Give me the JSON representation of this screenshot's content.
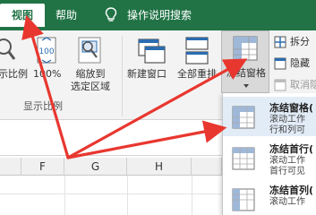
{
  "tabs": {
    "view": "视图",
    "help": "帮助",
    "tell_me": "操作说明搜索"
  },
  "ribbon": {
    "zoom_label": "示比例",
    "zoom100_label": "100%",
    "zoom_selection_line1": "缩放到",
    "zoom_selection_line2": "选定区域",
    "group_zoom": "显示比例",
    "new_window": "新建窗口",
    "arrange_all": "全部重排",
    "freeze_panes": "冻结窗格",
    "split": "拆分",
    "hide": "隐藏",
    "unhide": "取消隐"
  },
  "columns": [
    "F",
    "G",
    "H"
  ],
  "dropdown": {
    "items": [
      {
        "title": "冻结窗格(",
        "desc1": "滚动工作",
        "desc2": "行和列可"
      },
      {
        "title": "冻结首行(",
        "desc1": "滚动工作",
        "desc2": "首行可见"
      },
      {
        "title": "冻结首列(",
        "desc1": "滚动工作",
        "desc2": ""
      }
    ]
  },
  "colors": {
    "tab_green": "#217346",
    "arrow_red": "#e8372f",
    "highlight": "#e2ecf7"
  }
}
